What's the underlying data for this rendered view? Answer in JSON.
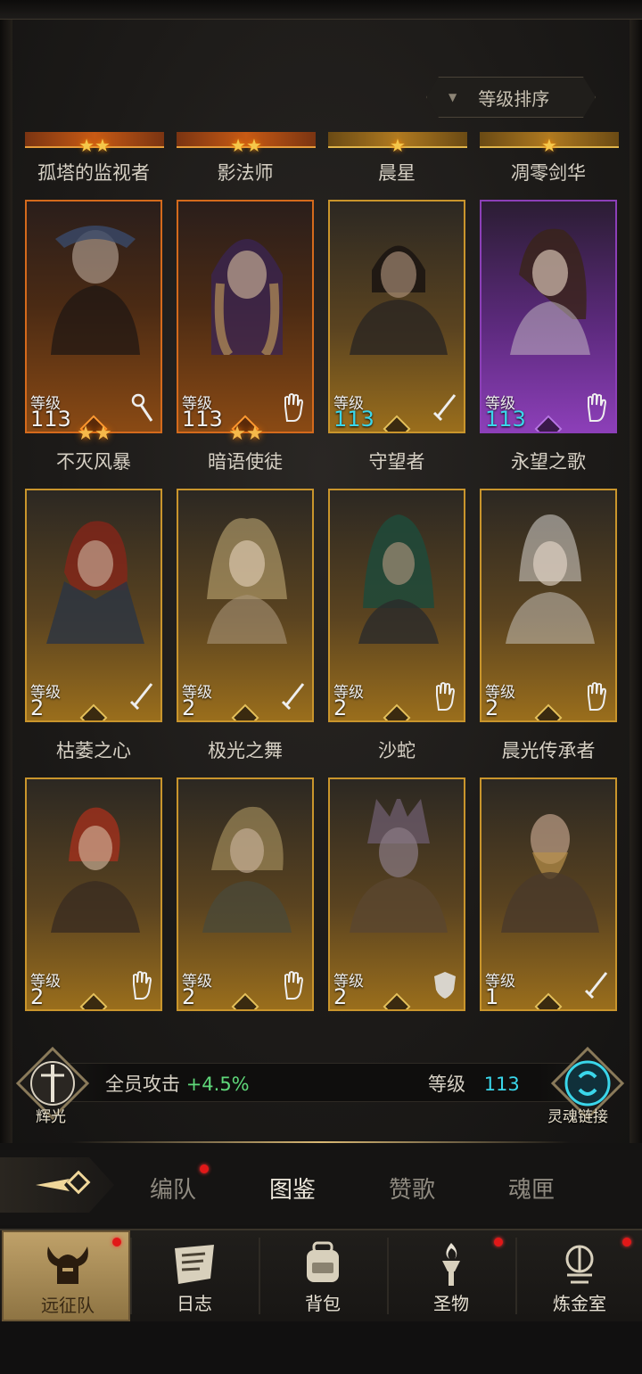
{
  "sort_button": {
    "label": "等级排序"
  },
  "top_row_names": [
    "孤塔的监视者",
    "影法师",
    "晨星",
    "凋零剑华"
  ],
  "cards": [
    {
      "name": "不灭风暴",
      "level_label": "等级",
      "level": "113",
      "class_icon": "staff-icon",
      "rarity": "orange",
      "level_color": "white"
    },
    {
      "name": "暗语使徒",
      "level_label": "等级",
      "level": "113",
      "class_icon": "hand-icon",
      "rarity": "orange",
      "level_color": "white"
    },
    {
      "name": "守望者",
      "level_label": "等级",
      "level": "113",
      "class_icon": "sword-icon",
      "rarity": "gold",
      "level_color": "cyan"
    },
    {
      "name": "永望之歌",
      "level_label": "等级",
      "level": "113",
      "class_icon": "hand-icon",
      "rarity": "purple",
      "level_color": "cyan"
    },
    {
      "name": "枯萎之心",
      "level_label": "等级",
      "level": "2",
      "class_icon": "sword-icon",
      "rarity": "gold",
      "level_color": "white"
    },
    {
      "name": "极光之舞",
      "level_label": "等级",
      "level": "2",
      "class_icon": "sword-icon",
      "rarity": "gold",
      "level_color": "white"
    },
    {
      "name": "沙蛇",
      "level_label": "等级",
      "level": "2",
      "class_icon": "hand-icon",
      "rarity": "gold",
      "level_color": "white"
    },
    {
      "name": "晨光传承者",
      "level_label": "等级",
      "level": "2",
      "class_icon": "hand-icon",
      "rarity": "gold",
      "level_color": "white"
    },
    {
      "name": "",
      "level_label": "等级",
      "level": "2",
      "class_icon": "hand-icon",
      "rarity": "gold",
      "level_color": "white"
    },
    {
      "name": "",
      "level_label": "等级",
      "level": "2",
      "class_icon": "hand-icon",
      "rarity": "gold",
      "level_color": "white"
    },
    {
      "name": "",
      "level_label": "等级",
      "level": "2",
      "class_icon": "shield-icon",
      "rarity": "gold",
      "level_color": "white"
    },
    {
      "name": "",
      "level_label": "等级",
      "level": "1",
      "class_icon": "sword-icon",
      "rarity": "gold",
      "level_color": "white"
    }
  ],
  "bonus": {
    "left_emblem_label": "辉光",
    "attack_label": "全员攻击",
    "attack_value": "+4.5%",
    "level_label": "等级",
    "level_value": "113",
    "right_emblem_label": "灵魂链接"
  },
  "subtabs": [
    {
      "label": "编队",
      "active": false,
      "badge": true
    },
    {
      "label": "图鉴",
      "active": true,
      "badge": false
    },
    {
      "label": "赞歌",
      "active": false,
      "badge": false
    },
    {
      "label": "魂匣",
      "active": false,
      "badge": false
    }
  ],
  "nav": [
    {
      "label": "远征队",
      "icon": "horned-helmet-icon",
      "active": true,
      "badge": true
    },
    {
      "label": "日志",
      "icon": "scroll-icon",
      "active": false,
      "badge": false
    },
    {
      "label": "背包",
      "icon": "backpack-icon",
      "active": false,
      "badge": false
    },
    {
      "label": "圣物",
      "icon": "torch-icon",
      "active": false,
      "badge": true
    },
    {
      "label": "炼金室",
      "icon": "alchemy-icon",
      "active": false,
      "badge": true
    }
  ],
  "colors": {
    "accent_gold": "#c9952c",
    "rarity_orange": "#d46a1c",
    "rarity_purple": "#8c3fb8",
    "level_cyan": "#3ad6ea",
    "bonus_green": "#5fd87a",
    "badge_red": "#e11818"
  }
}
